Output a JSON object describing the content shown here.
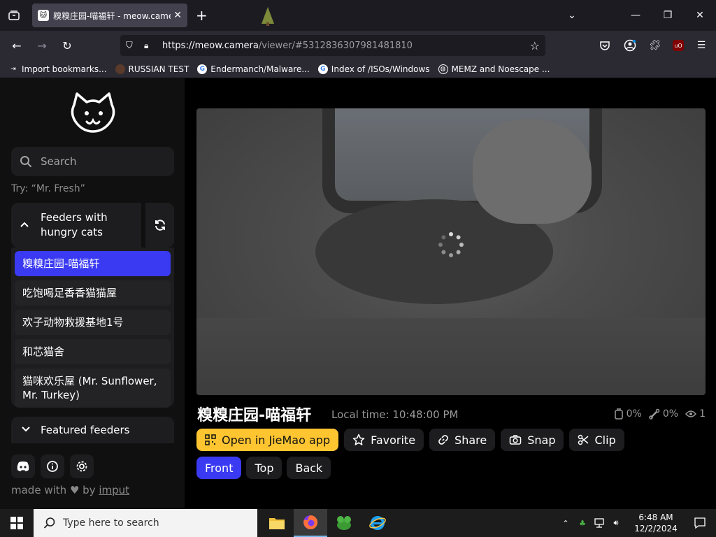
{
  "browser": {
    "tab": {
      "favicon": "cat-face-icon",
      "title": "糗糗庄园-喵福轩 - meow.camera"
    },
    "new_tab_label": "+",
    "address": {
      "scheme_host": "https://meow.camera",
      "path": "/viewer/#5312836307981481810"
    },
    "bookmarks": [
      {
        "icon": "import-icon",
        "label": "Import bookmarks..."
      },
      {
        "icon": "russian-test-icon",
        "label": "RUSSIAN TEST"
      },
      {
        "icon": "google-icon",
        "label": "Endermanch/Malware..."
      },
      {
        "icon": "google-icon",
        "label": "Index of /ISOs/Windows"
      },
      {
        "icon": "globe-icon",
        "label": "MEMZ and Noescape ..."
      }
    ],
    "extensions": [
      "pocket-icon",
      "account-icon",
      "extensions-icon",
      "ublock-icon",
      "menu-icon"
    ]
  },
  "sidebar": {
    "search_placeholder": "Search",
    "try_hint": "Try: “Mr. Fresh”",
    "section_title": "Feeders with hungry cats",
    "feeders": [
      "糗糗庄园-喵福轩",
      "吃饱喝足香香猫猫屋",
      "欢子动物救援基地1号",
      "和芯猫舍",
      "猫咪欢乐屋 (Mr. Sunflower, Mr. Turkey)"
    ],
    "featured_title": "Featured feeders",
    "footer_made": "made with",
    "footer_by": "by",
    "footer_link": "imput"
  },
  "viewer": {
    "feeder_name": "糗糗庄园-喵福轩",
    "local_time": "Local time: 10:48:00 PM",
    "stats": {
      "food": "0%",
      "treat": "0%",
      "viewers": "1"
    },
    "actions": {
      "open_app": "Open in JieMao app",
      "favorite": "Favorite",
      "share": "Share",
      "snap": "Snap",
      "clip": "Clip"
    },
    "camera_views": [
      "Front",
      "Top",
      "Back"
    ],
    "active_view": "Front"
  },
  "taskbar": {
    "search_placeholder": "Type here to search",
    "time": "6:48 AM",
    "date": "12/2/2024"
  },
  "colors": {
    "accent_blue": "#3a3af2",
    "accent_yellow": "#ffc531"
  }
}
